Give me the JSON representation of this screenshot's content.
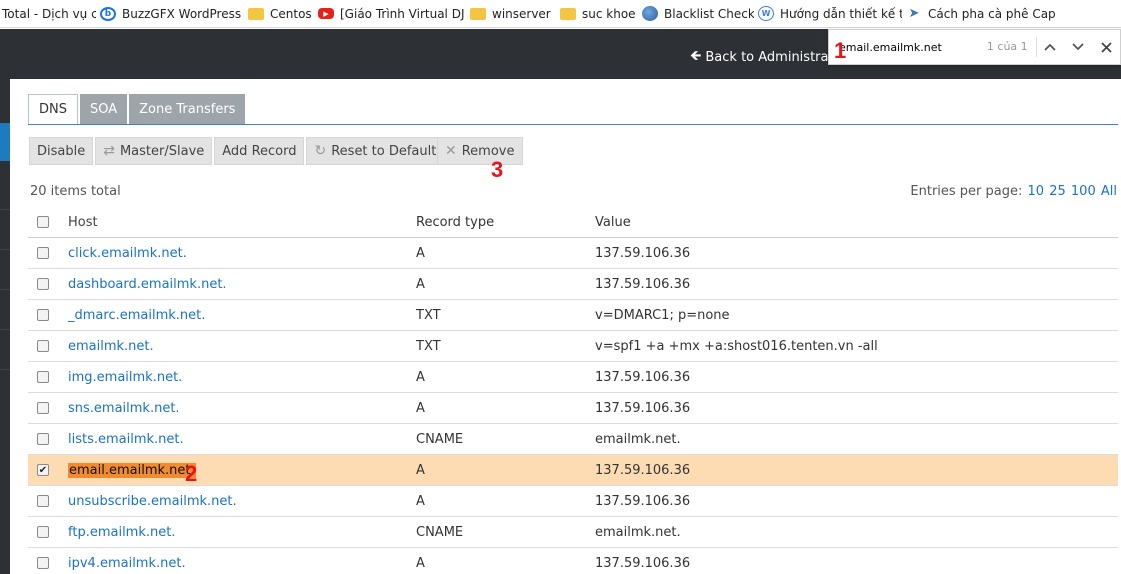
{
  "bookmarks": [
    {
      "label": "Total - Dịch vụ c",
      "icon": "none"
    },
    {
      "label": "BuzzGFX WordPress /",
      "icon": "circle-b-icon"
    },
    {
      "label": "Centos",
      "icon": "folder-icon"
    },
    {
      "label": "[Giáo Trình Virtual DJ",
      "icon": "youtube-icon"
    },
    {
      "label": "winserver",
      "icon": "folder-icon"
    },
    {
      "label": "suc khoe",
      "icon": "folder-icon"
    },
    {
      "label": "Blacklist Check",
      "icon": "globe-icon"
    },
    {
      "label": "Hướng dẫn thiết kế t",
      "icon": "wordpress-icon"
    },
    {
      "label": "Cách pha cà phê Cap",
      "icon": "arrow-icon"
    }
  ],
  "header": {
    "back_label": "Back to Administrat"
  },
  "findbar": {
    "query": "email.emailmk.net",
    "count": "1 của 1"
  },
  "tabs": [
    "DNS",
    "SOA",
    "Zone Transfers"
  ],
  "toolbar": {
    "disable": "Disable",
    "master_slave": "Master/Slave",
    "add_record": "Add Record",
    "reset_default": "Reset to Default",
    "remove": "Remove"
  },
  "summary": {
    "items_total": "20 items total",
    "entries_label": "Entries per page:",
    "entries_options": [
      "10",
      "25",
      "100",
      "All"
    ]
  },
  "table": {
    "headers": {
      "host": "Host",
      "type": "Record type",
      "value": "Value"
    },
    "rows": [
      {
        "host": "click.emailmk.net.",
        "type": "A",
        "value": "137.59.106.36",
        "checked": false
      },
      {
        "host": "dashboard.emailmk.net.",
        "type": "A",
        "value": "137.59.106.36",
        "checked": false
      },
      {
        "host": "_dmarc.emailmk.net.",
        "type": "TXT",
        "value": "v=DMARC1; p=none",
        "checked": false
      },
      {
        "host": "emailmk.net.",
        "type": "TXT",
        "value": "v=spf1 +a +mx +a:shost016.tenten.vn -all",
        "checked": false
      },
      {
        "host": "img.emailmk.net.",
        "type": "A",
        "value": "137.59.106.36",
        "checked": false
      },
      {
        "host": "sns.emailmk.net.",
        "type": "A",
        "value": "137.59.106.36",
        "checked": false
      },
      {
        "host": "lists.emailmk.net.",
        "type": "CNAME",
        "value": "emailmk.net.",
        "checked": false
      },
      {
        "host": "email.emailmk.net.",
        "type": "A",
        "value": "137.59.106.36",
        "checked": true
      },
      {
        "host": "unsubscribe.emailmk.net.",
        "type": "A",
        "value": "137.59.106.36",
        "checked": false
      },
      {
        "host": "ftp.emailmk.net.",
        "type": "CNAME",
        "value": "emailmk.net.",
        "checked": false
      },
      {
        "host": "ipv4.emailmk.net.",
        "type": "A",
        "value": "137.59.106.36",
        "checked": false
      }
    ]
  },
  "annotations": {
    "n1": "1",
    "n2": "2",
    "n3": "3"
  },
  "colors": {
    "accent": "#1f7bc0",
    "selected_row": "#fddcb4",
    "highlight": "#f28b30",
    "annotation": "#e8141c"
  }
}
